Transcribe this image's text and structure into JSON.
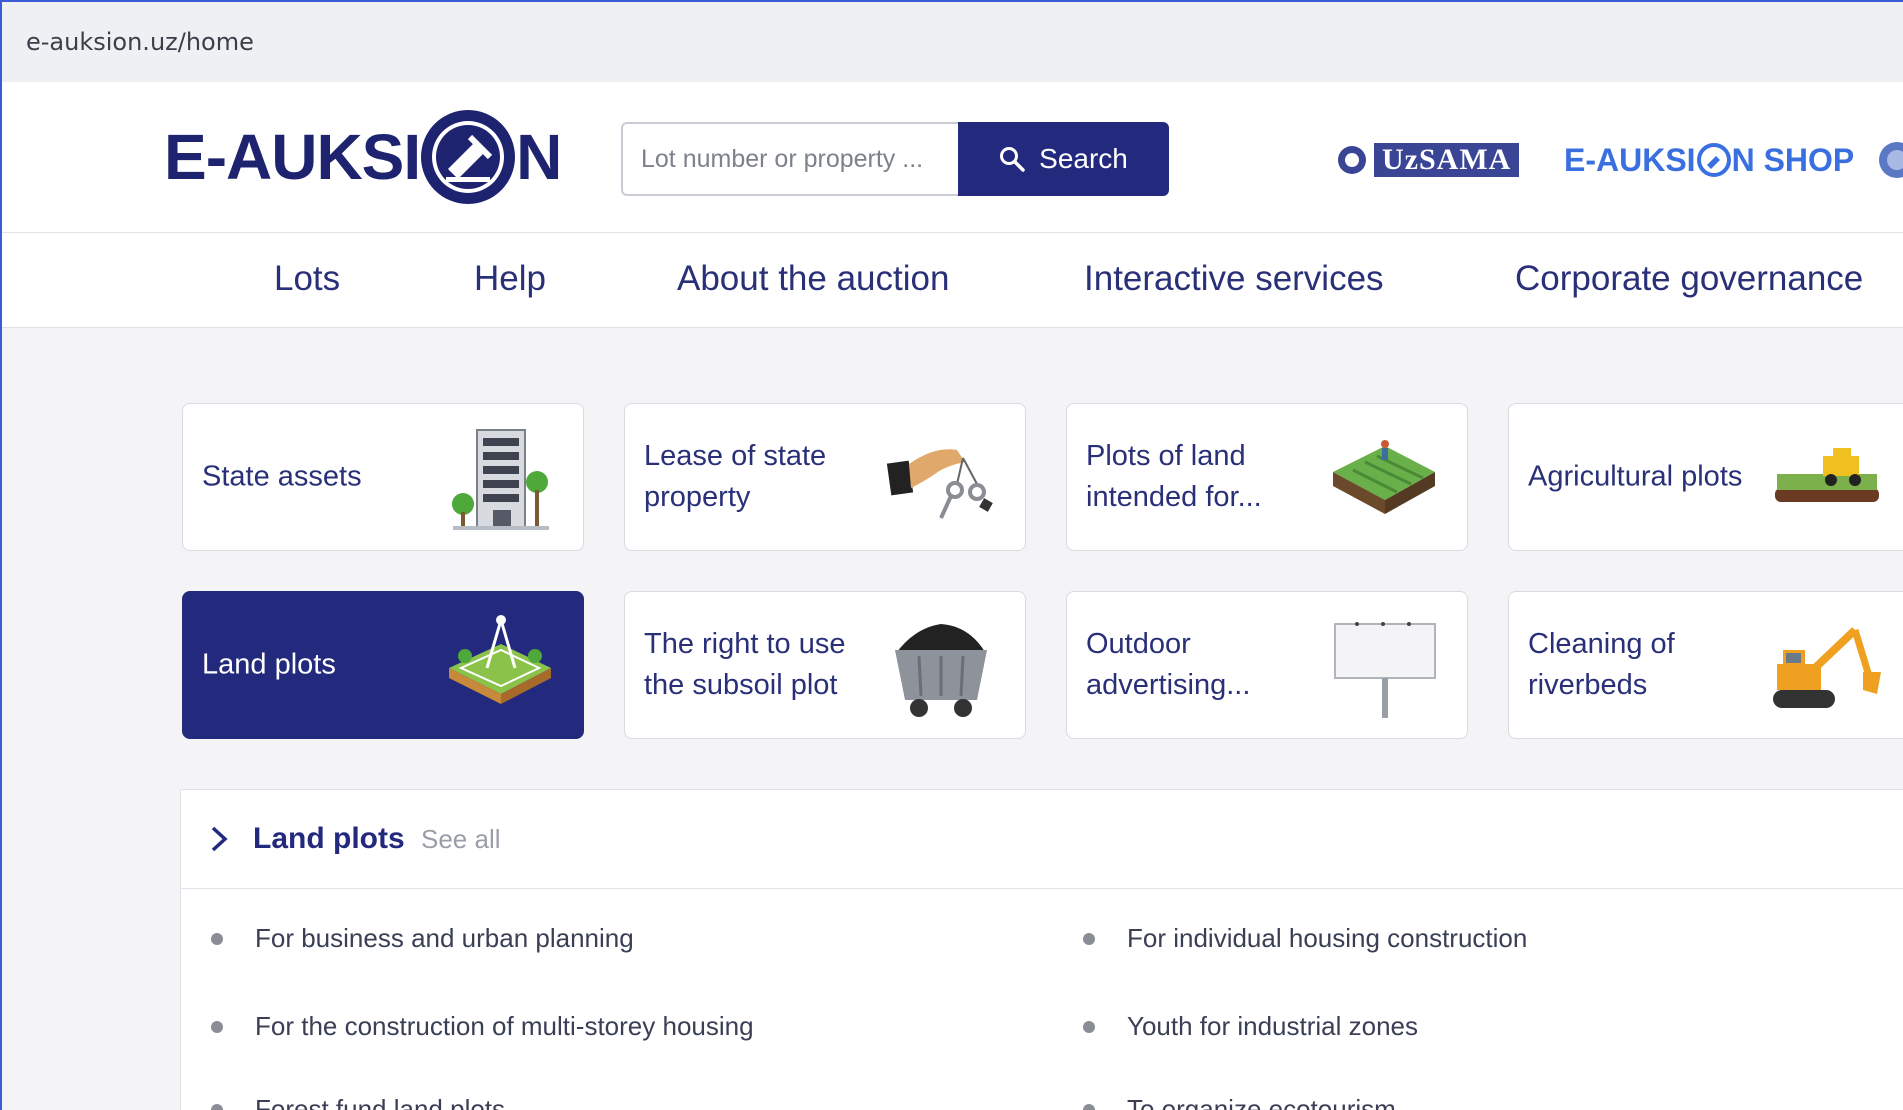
{
  "browser": {
    "url": "e-auksion.uz/home"
  },
  "header": {
    "logo_text_left": "E-AUKSI",
    "logo_text_right": "N",
    "search": {
      "placeholder": "Lot number or property ...",
      "button_label": "Search"
    },
    "partners": {
      "uzsama": "UzSAMA",
      "shop_left": "E-AUKSI",
      "shop_right": "N SHOP"
    }
  },
  "nav": {
    "items": [
      "Lots",
      "Help",
      "About the auction",
      "Interactive services",
      "Corporate governance"
    ]
  },
  "categories": [
    {
      "label": "State assets",
      "icon": "building-icon"
    },
    {
      "label": "Lease of state property",
      "icon": "hand-keys-icon"
    },
    {
      "label": "Plots of land intended for...",
      "icon": "farm-plot-icon"
    },
    {
      "label": "Agricultural plots",
      "icon": "harvester-icon"
    },
    {
      "label": "Land plots",
      "icon": "land-plot-icon",
      "active": true
    },
    {
      "label": "The right to use the subsoil plot",
      "icon": "coal-cart-icon"
    },
    {
      "label": "Outdoor advertising...",
      "icon": "billboard-icon"
    },
    {
      "label": "Cleaning of riverbeds",
      "icon": "excavator-icon"
    }
  ],
  "section": {
    "title": "Land plots",
    "see_all": "See all",
    "left_items": [
      "For business and urban planning",
      "For the construction of multi-storey housing",
      "Forest fund land plots"
    ],
    "right_items": [
      "For individual housing construction",
      "Youth for industrial zones",
      "To organize ecotourism"
    ]
  },
  "colors": {
    "brand": "#232a7e",
    "accent": "#3a6fe0",
    "background": "#f4f4f6"
  }
}
